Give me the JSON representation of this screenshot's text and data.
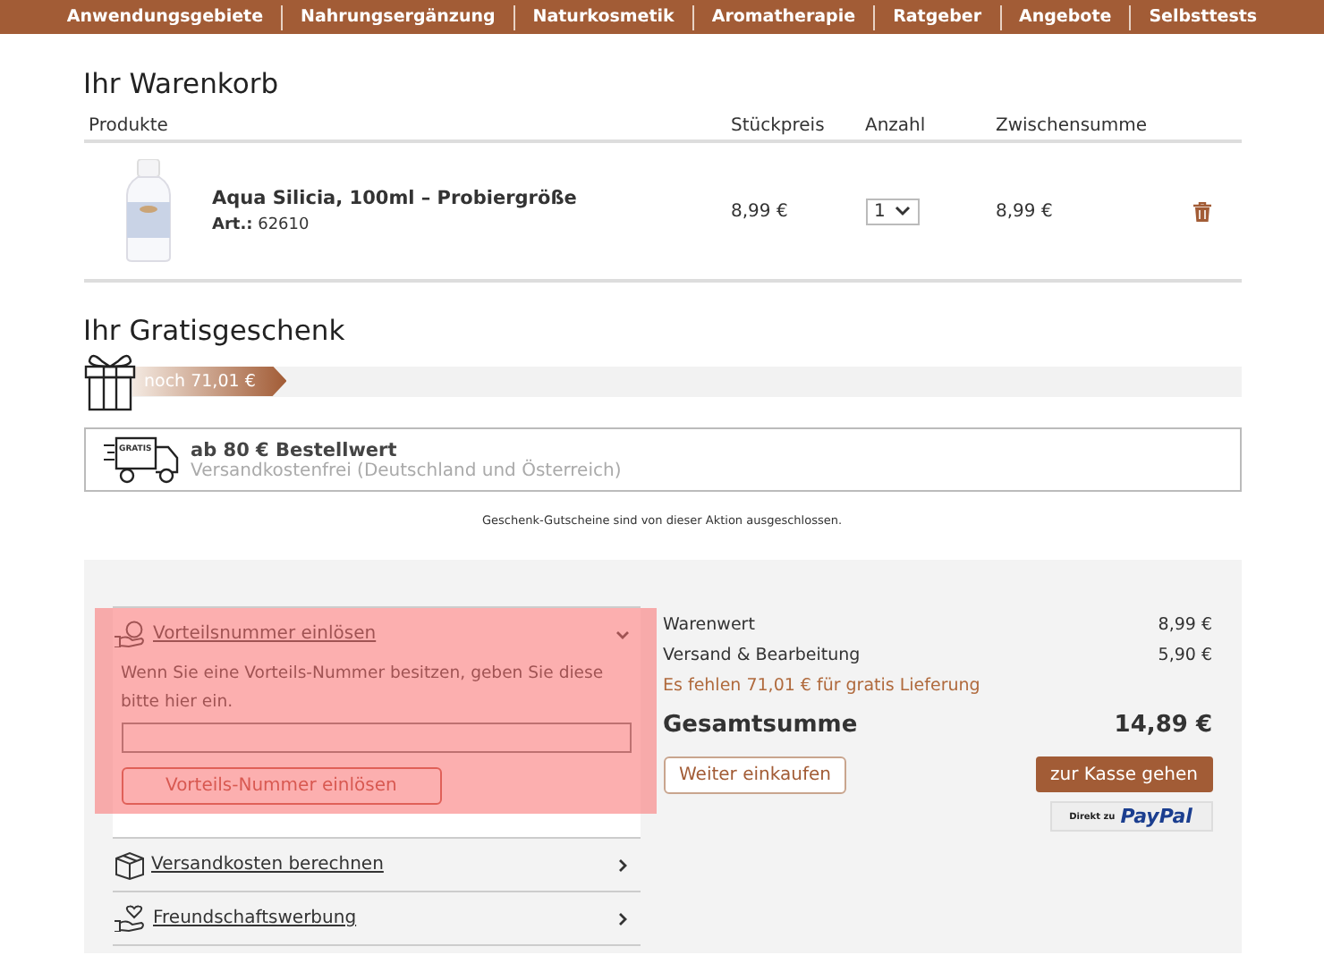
{
  "nav": [
    "Anwendungsgebiete",
    "Nahrungsergänzung",
    "Naturkosmetik",
    "Aromatherapie",
    "Ratgeber",
    "Angebote",
    "Selbsttests"
  ],
  "cart": {
    "title": "Ihr Warenkorb",
    "columns": [
      "Produkte",
      "Stückpreis",
      "Anzahl",
      "Zwischensumme"
    ],
    "items": [
      {
        "name": "Aqua Silicia, 100ml – Probiergröße",
        "article_label": "Art.:",
        "article_number": "62610",
        "unit_price": "8,99 €",
        "quantity": "1",
        "subtotal": "8,99 €"
      }
    ]
  },
  "gift": {
    "title": "Ihr Gratisgeschenk",
    "remaining": "noch 71,01 €",
    "level": 0.14,
    "threshold": "ab 80 € Bestellwert",
    "badge": "GRATIS",
    "description": "Versandkostenfrei (Deutschland und Österreich)",
    "note": "Geschenk-Gutscheine sind von dieser Aktion ausgeschlossen."
  },
  "accordion": [
    {
      "kind": "voucher",
      "title": "Vorteilsnummer einlösen",
      "expanded": true,
      "highlighted": true,
      "text": "Wenn Sie eine Vorteils-Nummer besitzen, geben Sie diese bitte hier ein.",
      "button": "Vorteils-Nummer einlösen"
    },
    {
      "kind": "shipping",
      "title": "Versandkosten berechnen",
      "expanded": false,
      "highlighted": false
    },
    {
      "kind": "referral",
      "title": "Freundschaftswerbung",
      "expanded": false,
      "highlighted": false
    }
  ],
  "summary": {
    "rows": [
      {
        "label": "Warenwert",
        "value": "8,99 €"
      },
      {
        "label": "Versand & Bearbeitung",
        "value": "5,90 €"
      }
    ],
    "notice": "Es fehlen 71,01 € für gratis Lieferung",
    "total_label": "Gesamtsumme",
    "total_value": "14,89 €",
    "continue_button": "Weiter einkaufen",
    "checkout_button": "zur Kasse gehen",
    "paypal_prefix": "Direkt zu",
    "paypal_brand": "PayPal"
  }
}
